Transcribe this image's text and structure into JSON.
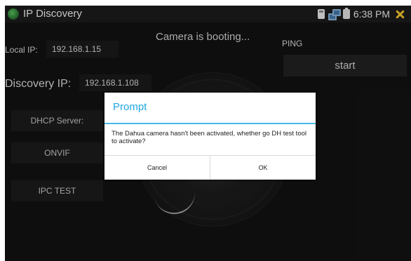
{
  "statusbar": {
    "title": "IP Discovery",
    "time": "6:38 PM",
    "icons": [
      "app-icon",
      "sd-card-icon",
      "network-icon",
      "battery-icon",
      "close-icon"
    ]
  },
  "main": {
    "booting_text": "Camera is booting...",
    "local_ip_label": "Local IP:",
    "local_ip_value": "192.168.1.15",
    "discovery_ip_label": "Discovery IP:",
    "discovery_ip_value": "192.168.1.108",
    "ping_label": "PING",
    "start_button": "start",
    "buttons": {
      "dhcp": "DHCP Server:",
      "onvif": "ONVIF",
      "ipc_test": "IPC TEST"
    }
  },
  "dialog": {
    "title": "Prompt",
    "message": "The Dahua camera hasn't been activated, whether go DH test tool to activate?",
    "cancel": "Cancel",
    "ok": "OK"
  },
  "colors": {
    "screen_background": "#121212",
    "dialog_title": "#22a8e1",
    "dialog_rule": "#47b8e8",
    "close_icon": "#f2c42f"
  }
}
